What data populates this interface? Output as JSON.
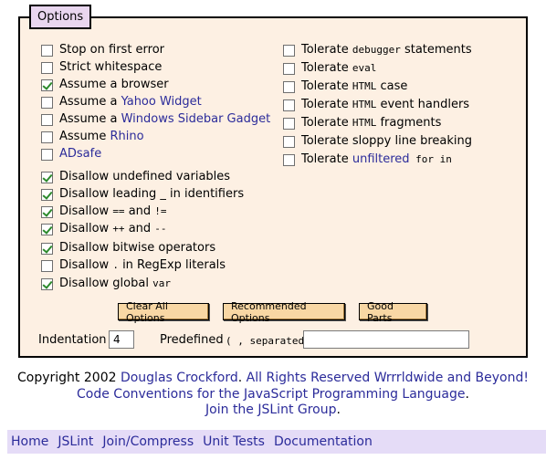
{
  "options": {
    "legend": "Options",
    "left_column": [
      {
        "label": "Stop on first error",
        "checked": false
      },
      {
        "label": "Strict whitespace",
        "checked": false
      },
      {
        "label": "Assume a browser",
        "checked": true
      },
      {
        "pre": "Assume a ",
        "link": "Yahoo Widget",
        "checked": false
      },
      {
        "pre": "Assume a ",
        "link": "Windows Sidebar Gadget",
        "checked": false
      },
      {
        "pre": "Assume ",
        "link": "Rhino",
        "checked": false
      },
      {
        "link": "ADsafe",
        "checked": false
      },
      {
        "label": "Disallow undefined variables",
        "checked": true
      },
      {
        "label": "Disallow leading _ in identifiers",
        "checked": true
      },
      {
        "pre": "Disallow ",
        "code": "==",
        "mid": " and ",
        "code2": "!=",
        "checked": true
      },
      {
        "pre": "Disallow ",
        "code": "++",
        "mid": " and ",
        "code2": "--",
        "checked": true
      },
      {
        "label": "Disallow bitwise operators",
        "checked": true
      },
      {
        "pre": "Disallow ",
        "code": ".",
        "mid": " in RegExp literals",
        "checked": false
      },
      {
        "pre": "Disallow global ",
        "code": "var",
        "checked": true
      }
    ],
    "right_column": [
      {
        "pre": "Tolerate ",
        "code": "debugger",
        "post": " statements",
        "checked": false
      },
      {
        "pre": "Tolerate ",
        "code": "eval",
        "checked": false
      },
      {
        "pre": "Tolerate ",
        "code": "HTML",
        "post": " case",
        "checked": false
      },
      {
        "pre": "Tolerate ",
        "code": "HTML",
        "post": " event handlers",
        "checked": false
      },
      {
        "pre": "Tolerate ",
        "code": "HTML",
        "post": " fragments",
        "checked": false
      },
      {
        "label": "Tolerate sloppy line breaking",
        "checked": false
      },
      {
        "pre": "Tolerate ",
        "link": "unfiltered",
        "code": " for in",
        "checked": false
      }
    ]
  },
  "buttons": {
    "clear": "Clear All Options",
    "recommended": "Recommended Options",
    "good_parts": "Good Parts"
  },
  "indentation": {
    "label": "Indentation",
    "value": "4"
  },
  "predefined": {
    "label": "Predefined",
    "hint": "( , separated)",
    "value": ""
  },
  "footer": {
    "line1_pre": "Copyright 2002 ",
    "line1_link": "Douglas Crockford",
    "line1_mid": ". ",
    "line1_link2": "All Rights Reserved Wrrrldwide and Beyond!",
    "line2_link": "Code Conventions for the JavaScript Programming Language",
    "line2_post": ".",
    "line3_link": "Join the JSLint Group",
    "line3_post": "."
  },
  "nav": [
    "Home",
    "JSLint",
    "Join/Compress",
    "Unit Tests",
    "Documentation"
  ]
}
